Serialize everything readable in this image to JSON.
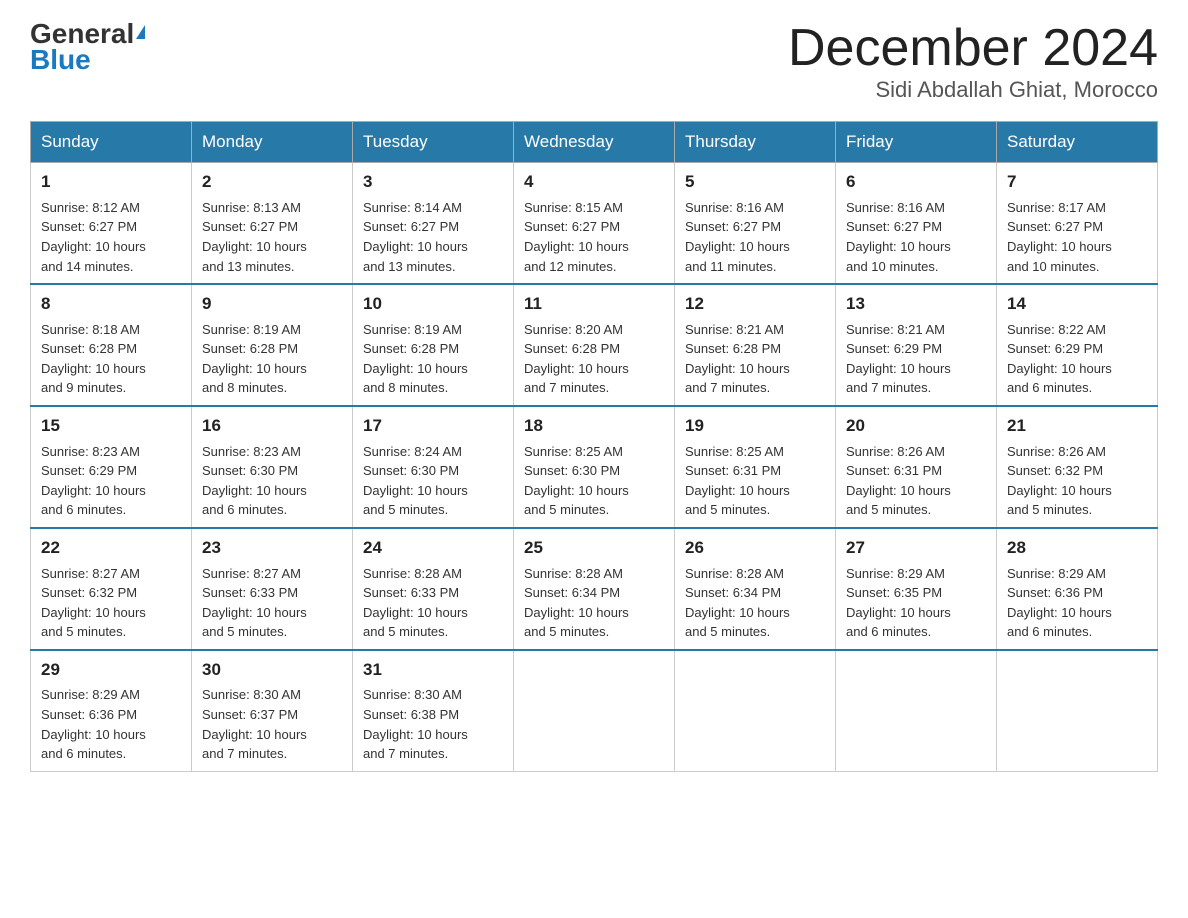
{
  "header": {
    "logo_general": "General",
    "logo_blue": "Blue",
    "month_title": "December 2024",
    "location": "Sidi Abdallah Ghiat, Morocco"
  },
  "days_of_week": [
    "Sunday",
    "Monday",
    "Tuesday",
    "Wednesday",
    "Thursday",
    "Friday",
    "Saturday"
  ],
  "weeks": [
    [
      {
        "day": "1",
        "sunrise": "8:12 AM",
        "sunset": "6:27 PM",
        "daylight": "10 hours and 14 minutes."
      },
      {
        "day": "2",
        "sunrise": "8:13 AM",
        "sunset": "6:27 PM",
        "daylight": "10 hours and 13 minutes."
      },
      {
        "day": "3",
        "sunrise": "8:14 AM",
        "sunset": "6:27 PM",
        "daylight": "10 hours and 13 minutes."
      },
      {
        "day": "4",
        "sunrise": "8:15 AM",
        "sunset": "6:27 PM",
        "daylight": "10 hours and 12 minutes."
      },
      {
        "day": "5",
        "sunrise": "8:16 AM",
        "sunset": "6:27 PM",
        "daylight": "10 hours and 11 minutes."
      },
      {
        "day": "6",
        "sunrise": "8:16 AM",
        "sunset": "6:27 PM",
        "daylight": "10 hours and 10 minutes."
      },
      {
        "day": "7",
        "sunrise": "8:17 AM",
        "sunset": "6:27 PM",
        "daylight": "10 hours and 10 minutes."
      }
    ],
    [
      {
        "day": "8",
        "sunrise": "8:18 AM",
        "sunset": "6:28 PM",
        "daylight": "10 hours and 9 minutes."
      },
      {
        "day": "9",
        "sunrise": "8:19 AM",
        "sunset": "6:28 PM",
        "daylight": "10 hours and 8 minutes."
      },
      {
        "day": "10",
        "sunrise": "8:19 AM",
        "sunset": "6:28 PM",
        "daylight": "10 hours and 8 minutes."
      },
      {
        "day": "11",
        "sunrise": "8:20 AM",
        "sunset": "6:28 PM",
        "daylight": "10 hours and 7 minutes."
      },
      {
        "day": "12",
        "sunrise": "8:21 AM",
        "sunset": "6:28 PM",
        "daylight": "10 hours and 7 minutes."
      },
      {
        "day": "13",
        "sunrise": "8:21 AM",
        "sunset": "6:29 PM",
        "daylight": "10 hours and 7 minutes."
      },
      {
        "day": "14",
        "sunrise": "8:22 AM",
        "sunset": "6:29 PM",
        "daylight": "10 hours and 6 minutes."
      }
    ],
    [
      {
        "day": "15",
        "sunrise": "8:23 AM",
        "sunset": "6:29 PM",
        "daylight": "10 hours and 6 minutes."
      },
      {
        "day": "16",
        "sunrise": "8:23 AM",
        "sunset": "6:30 PM",
        "daylight": "10 hours and 6 minutes."
      },
      {
        "day": "17",
        "sunrise": "8:24 AM",
        "sunset": "6:30 PM",
        "daylight": "10 hours and 5 minutes."
      },
      {
        "day": "18",
        "sunrise": "8:25 AM",
        "sunset": "6:30 PM",
        "daylight": "10 hours and 5 minutes."
      },
      {
        "day": "19",
        "sunrise": "8:25 AM",
        "sunset": "6:31 PM",
        "daylight": "10 hours and 5 minutes."
      },
      {
        "day": "20",
        "sunrise": "8:26 AM",
        "sunset": "6:31 PM",
        "daylight": "10 hours and 5 minutes."
      },
      {
        "day": "21",
        "sunrise": "8:26 AM",
        "sunset": "6:32 PM",
        "daylight": "10 hours and 5 minutes."
      }
    ],
    [
      {
        "day": "22",
        "sunrise": "8:27 AM",
        "sunset": "6:32 PM",
        "daylight": "10 hours and 5 minutes."
      },
      {
        "day": "23",
        "sunrise": "8:27 AM",
        "sunset": "6:33 PM",
        "daylight": "10 hours and 5 minutes."
      },
      {
        "day": "24",
        "sunrise": "8:28 AM",
        "sunset": "6:33 PM",
        "daylight": "10 hours and 5 minutes."
      },
      {
        "day": "25",
        "sunrise": "8:28 AM",
        "sunset": "6:34 PM",
        "daylight": "10 hours and 5 minutes."
      },
      {
        "day": "26",
        "sunrise": "8:28 AM",
        "sunset": "6:34 PM",
        "daylight": "10 hours and 5 minutes."
      },
      {
        "day": "27",
        "sunrise": "8:29 AM",
        "sunset": "6:35 PM",
        "daylight": "10 hours and 6 minutes."
      },
      {
        "day": "28",
        "sunrise": "8:29 AM",
        "sunset": "6:36 PM",
        "daylight": "10 hours and 6 minutes."
      }
    ],
    [
      {
        "day": "29",
        "sunrise": "8:29 AM",
        "sunset": "6:36 PM",
        "daylight": "10 hours and 6 minutes."
      },
      {
        "day": "30",
        "sunrise": "8:30 AM",
        "sunset": "6:37 PM",
        "daylight": "10 hours and 7 minutes."
      },
      {
        "day": "31",
        "sunrise": "8:30 AM",
        "sunset": "6:38 PM",
        "daylight": "10 hours and 7 minutes."
      },
      null,
      null,
      null,
      null
    ]
  ],
  "labels": {
    "sunrise": "Sunrise:",
    "sunset": "Sunset:",
    "daylight": "Daylight:"
  }
}
